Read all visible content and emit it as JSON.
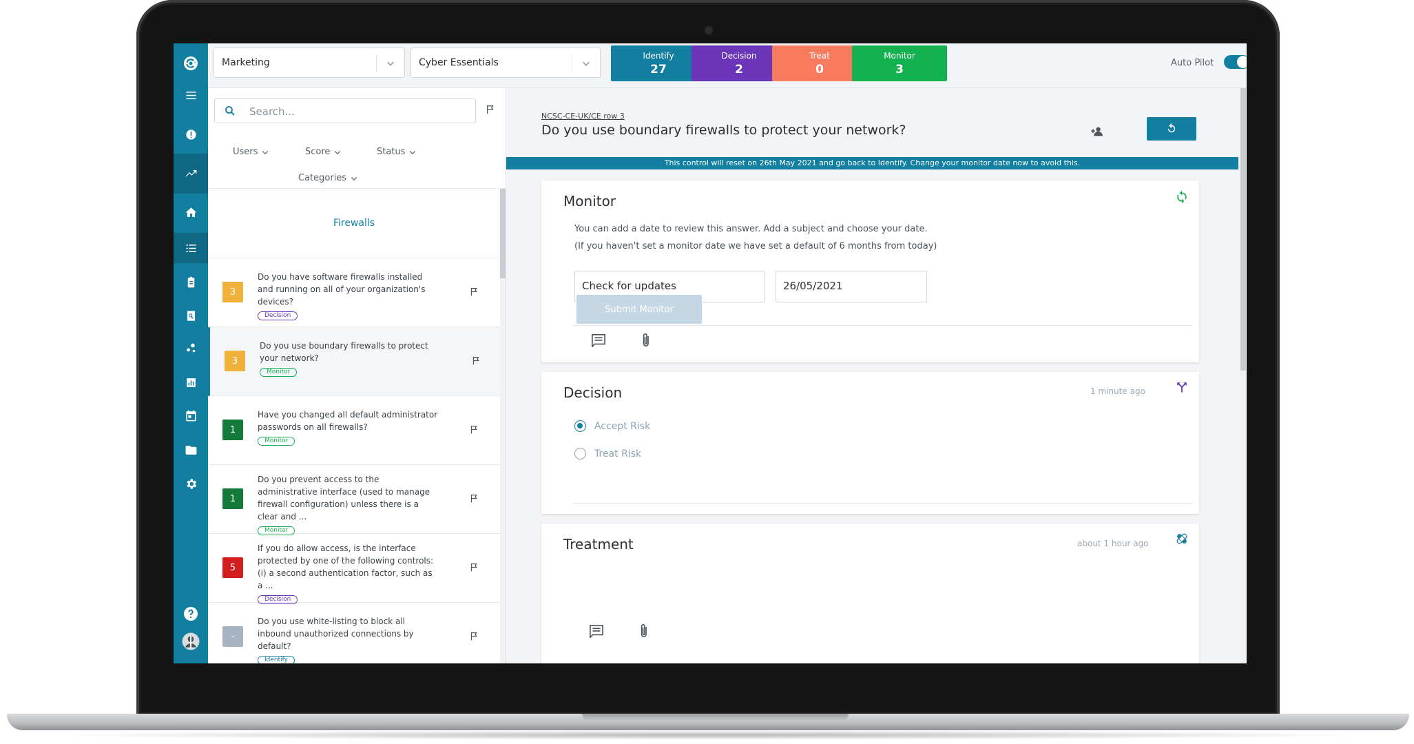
{
  "colors": {
    "brand": "#127fa0",
    "identify": "#127fa0",
    "decision": "#6a35b8",
    "treat": "#f97b5f",
    "monitor": "#14b150",
    "score_orange": "#f0b13a",
    "score_green": "#147a3a",
    "score_red": "#d41d1d",
    "score_grey": "#a6b4c2"
  },
  "topbar": {
    "department": "Marketing",
    "framework": "Cyber Essentials",
    "stats": [
      {
        "label": "Identify",
        "count": "27",
        "color": "#127fa0"
      },
      {
        "label": "Decision",
        "count": "2",
        "color": "#6a35b8"
      },
      {
        "label": "Treat",
        "count": "0",
        "color": "#f97b5f"
      },
      {
        "label": "Monitor",
        "count": "3",
        "color": "#14b150"
      }
    ],
    "autopilot_label": "Auto Pilot",
    "autopilot_on": true
  },
  "sidebar": {
    "icons": [
      "logo-icon",
      "menu-icon",
      "alert-icon",
      "trend-icon",
      "home-icon",
      "list-icon",
      "clipboard-icon",
      "search-doc-icon",
      "network-icon",
      "chart-icon",
      "calendar-icon",
      "folder-icon",
      "gear-icon",
      "help-icon",
      "avatar"
    ]
  },
  "list": {
    "search_placeholder": "Search...",
    "filters": {
      "users": "Users",
      "score": "Score",
      "status": "Status",
      "categories": "Categories"
    },
    "section": "Firewalls",
    "items": [
      {
        "score": "3",
        "score_color": "#f0b13a",
        "text": "Do you have software firewalls installed and running on all of your organization's devices?",
        "tag": "Decision",
        "tag_color": "#6a35b8"
      },
      {
        "score": "3",
        "score_color": "#f0b13a",
        "text": "Do you use boundary firewalls to protect your network?",
        "tag": "Monitor",
        "tag_color": "#14b150"
      },
      {
        "score": "1",
        "score_color": "#147a3a",
        "text": "Have you changed all default administrator passwords on all firewalls?",
        "tag": "Monitor",
        "tag_color": "#14b150"
      },
      {
        "score": "1",
        "score_color": "#147a3a",
        "text": "Do you prevent access to the administrative interface (used to manage firewall configuration) unless there is a clear and ...",
        "tag": "Monitor",
        "tag_color": "#14b150"
      },
      {
        "score": "5",
        "score_color": "#d41d1d",
        "text": "If you do allow access, is the interface protected by one of the following controls: (i) a second authentication factor, such as a ...",
        "tag": "Decision",
        "tag_color": "#6a35b8"
      },
      {
        "score": "-",
        "score_color": "#a6b4c2",
        "text": "Do you use white-listing to block all inbound unauthorized connections by default?",
        "tag": "Identify",
        "tag_color": "#127fa0"
      }
    ]
  },
  "detail": {
    "breadcrumb": "NCSC-CE-UK/CE row 3",
    "title": "Do you use boundary firewalls to protect your network?",
    "banner": "This control will reset on 26th May 2021 and go back to Identify. Change your monitor date now to avoid this.",
    "monitor": {
      "title": "Monitor",
      "help_line1": "You can add a date to review this answer. Add a subject and choose your date.",
      "help_line2": "(If you haven't set a monitor date we have set a default of 6 months from today)",
      "subject_value": "Check for updates",
      "date_value": "26/05/2021",
      "submit_label": "Submit Monitor"
    },
    "decision": {
      "title": "Decision",
      "time_ago": "1 minute ago",
      "options": [
        {
          "label": "Accept Risk",
          "checked": true
        },
        {
          "label": "Treat Risk",
          "checked": false
        }
      ]
    },
    "treatment": {
      "title": "Treatment",
      "time_ago": "about 1 hour ago"
    }
  }
}
